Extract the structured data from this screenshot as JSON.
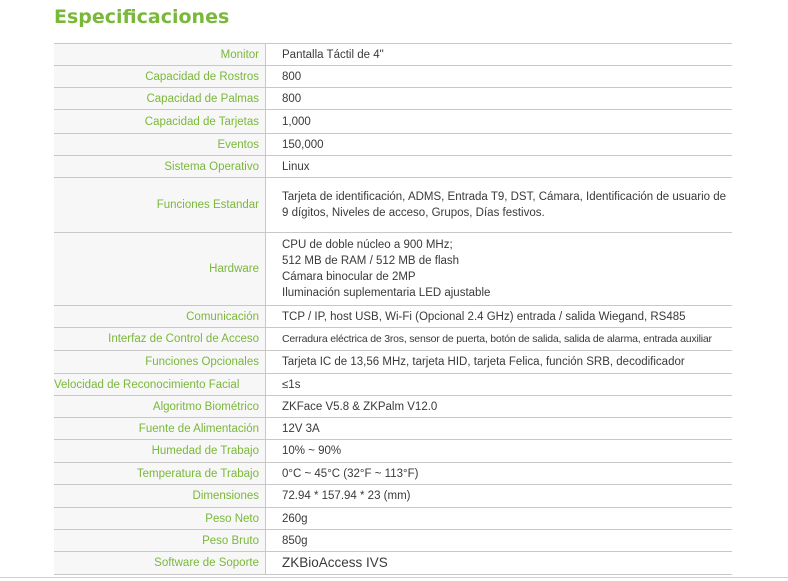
{
  "section": {
    "title": "Especificaciones"
  },
  "specs": [
    {
      "label": "Monitor",
      "value": [
        "Pantalla Táctil de 4\""
      ]
    },
    {
      "label": "Capacidad de Rostros",
      "value": [
        "800"
      ]
    },
    {
      "label": "Capacidad de Palmas",
      "value": [
        "800"
      ]
    },
    {
      "label": "Capacidad de Tarjetas",
      "value": [
        "1,000"
      ]
    },
    {
      "label": "Eventos",
      "value": [
        "150,000"
      ]
    },
    {
      "label": "Sistema Operativo",
      "value": [
        "Linux"
      ]
    },
    {
      "label": "Funciones Estandar",
      "value": [
        "Tarjeta de identificación, ADMS, Entrada T9, DST, Cámara, Identificación de usuario de 9 dígitos, Niveles de acceso, Grupos, Días festivos."
      ]
    },
    {
      "label": "Hardware",
      "value": [
        "CPU de doble núcleo a 900 MHz;",
        "512 MB de RAM / 512 MB de flash",
        "Cámara binocular de 2MP",
        "Iluminación suplementaria LED ajustable"
      ]
    },
    {
      "label": "Comunicación",
      "value": [
        "TCP / IP, host USB, Wi-Fi (Opcional 2.4 GHz) entrada / salida Wiegand, RS485"
      ]
    },
    {
      "label": "Interfaz de Control de Acceso",
      "value": [
        "Cerradura eléctrica de 3ros, sensor de puerta, botón de salida, salida de alarma, entrada auxiliar"
      ]
    },
    {
      "label": "Funciones Opcionales",
      "value": [
        "Tarjeta IC de 13,56 MHz, tarjeta HID, tarjeta Felica, función SRB, decodificador"
      ]
    },
    {
      "label": "Velocidad de Reconocimiento Facial",
      "value": [
        "≤1s"
      ]
    },
    {
      "label": "Algoritmo Biométrico",
      "value": [
        "ZKFace V5.8 & ZKPalm V12.0"
      ]
    },
    {
      "label": "Fuente de Alimentación",
      "value": [
        "12V 3A"
      ]
    },
    {
      "label": "Humedad de Trabajo",
      "value": [
        "10% ~ 90%"
      ]
    },
    {
      "label": "Temperatura de Trabajo",
      "value": [
        "0°C ~ 45°C (32°F ~ 113°F)"
      ]
    },
    {
      "label": "Dimensiones",
      "value": [
        "72.94 * 157.94 * 23 (mm)"
      ]
    },
    {
      "label": "Peso Neto",
      "value": [
        "260g"
      ]
    },
    {
      "label": "Peso Bruto",
      "value": [
        "850g"
      ]
    },
    {
      "label": "Software de Soporte",
      "value": [
        "ZKBioAccess IVS"
      ]
    }
  ]
}
